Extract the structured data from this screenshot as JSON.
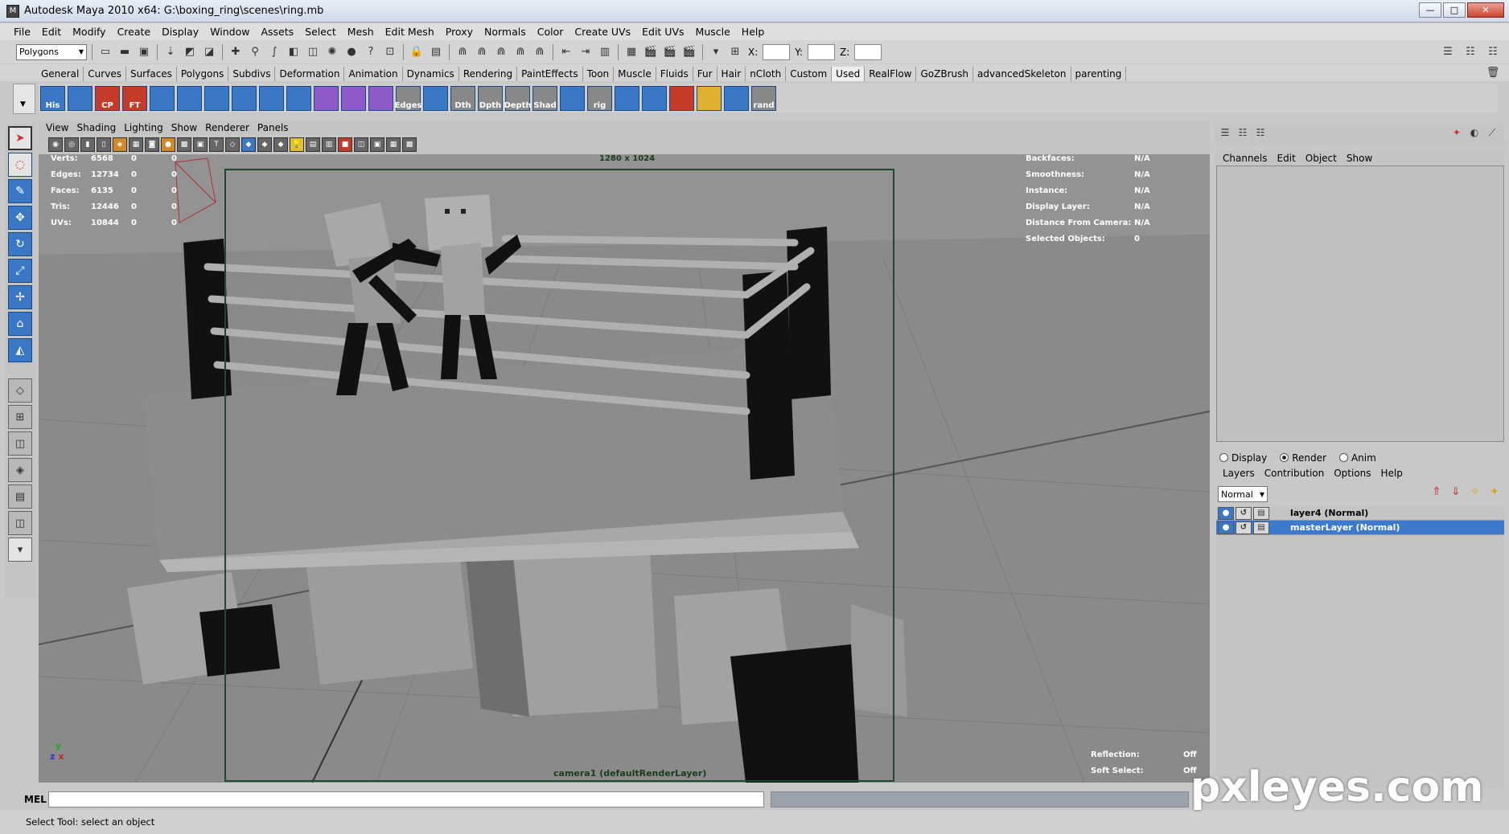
{
  "window": {
    "title": "Autodesk Maya 2010 x64: G:\\boxing_ring\\scenes\\ring.mb",
    "minimize": "—",
    "maximize": "□",
    "close": "✕"
  },
  "menubar": [
    "File",
    "Edit",
    "Modify",
    "Create",
    "Display",
    "Window",
    "Assets",
    "Select",
    "Mesh",
    "Edit Mesh",
    "Proxy",
    "Normals",
    "Color",
    "Create UVs",
    "Edit UVs",
    "Muscle",
    "Help"
  ],
  "statusline": {
    "mode_select": "Polygons",
    "x_label": "X:",
    "y_label": "Y:",
    "z_label": "Z:"
  },
  "shelf_tabs": [
    "General",
    "Curves",
    "Surfaces",
    "Polygons",
    "Subdivs",
    "Deformation",
    "Animation",
    "Dynamics",
    "Rendering",
    "PaintEffects",
    "Toon",
    "Muscle",
    "Fluids",
    "Fur",
    "Hair",
    "nCloth",
    "Custom",
    "Used",
    "RealFlow",
    "GoZBrush",
    "advancedSkeleton",
    "parenting"
  ],
  "shelf_active": "Used",
  "shelf_buttons": [
    "His",
    "",
    "CP",
    "FT",
    "",
    "",
    "",
    "",
    "",
    "",
    "",
    "",
    "",
    "Edges",
    "",
    "Dth",
    "Dpth",
    "Depth",
    "Shad",
    "",
    "rig",
    "",
    "",
    "",
    "",
    "",
    "rand"
  ],
  "panel_menu": [
    "View",
    "Shading",
    "Lighting",
    "Show",
    "Renderer",
    "Panels"
  ],
  "hud_left": [
    {
      "label": "Verts:",
      "a": "6568",
      "b": "0",
      "c": "0"
    },
    {
      "label": "Edges:",
      "a": "12734",
      "b": "0",
      "c": "0"
    },
    {
      "label": "Faces:",
      "a": "6135",
      "b": "0",
      "c": "0"
    },
    {
      "label": "Tris:",
      "a": "12446",
      "b": "0",
      "c": "0"
    },
    {
      "label": "UVs:",
      "a": "10844",
      "b": "0",
      "c": "0"
    }
  ],
  "hud_right": [
    {
      "label": "Backfaces:",
      "value": "N/A"
    },
    {
      "label": "Smoothness:",
      "value": "N/A"
    },
    {
      "label": "Instance:",
      "value": "N/A"
    },
    {
      "label": "Display Layer:",
      "value": "N/A"
    },
    {
      "label": "Distance From Camera:",
      "value": "N/A"
    },
    {
      "label": "Selected Objects:",
      "value": "0"
    }
  ],
  "hud_bottom_right": [
    {
      "label": "Reflection:",
      "value": "Off"
    },
    {
      "label": "Soft Select:",
      "value": "Off"
    }
  ],
  "resolution_gate": "1280 x 1024",
  "camera_label": "camera1 (defaultRenderLayer)",
  "axis": {
    "y": "y",
    "x": "x",
    "z": "z"
  },
  "channel_box_menu": [
    "Channels",
    "Edit",
    "Object",
    "Show"
  ],
  "layer_editor": {
    "radios": [
      {
        "label": "Display",
        "on": false
      },
      {
        "label": "Render",
        "on": true
      },
      {
        "label": "Anim",
        "on": false
      }
    ],
    "menu": [
      "Layers",
      "Contribution",
      "Options",
      "Help"
    ],
    "blend_mode": "Normal",
    "layers": [
      {
        "name": "layer4 (Normal)",
        "selected": false
      },
      {
        "name": "masterLayer (Normal)",
        "selected": true
      }
    ]
  },
  "command_line": {
    "label": "MEL"
  },
  "help_line": "Select Tool: select an object",
  "watermark": "pxleyes.com"
}
